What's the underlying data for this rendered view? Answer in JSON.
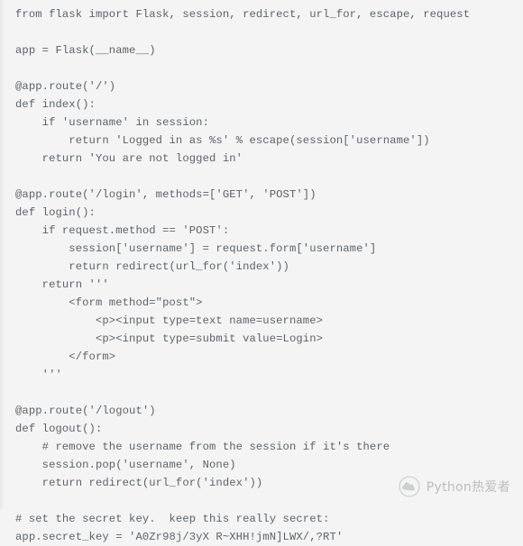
{
  "editor": {
    "language": "python",
    "background_color": "#f4f4f4",
    "text_color": "#5c6369",
    "left_border_color": "#ebebeb",
    "lines": [
      "from flask import Flask, session, redirect, url_for, escape, request",
      "",
      "app = Flask(__name__)",
      "",
      "@app.route('/')",
      "def index():",
      "    if 'username' in session:",
      "        return 'Logged in as %s' % escape(session['username'])",
      "    return 'You are not logged in'",
      "",
      "@app.route('/login', methods=['GET', 'POST'])",
      "def login():",
      "    if request.method == 'POST':",
      "        session['username'] = request.form['username']",
      "        return redirect(url_for('index'))",
      "    return '''",
      "        <form method=\"post\">",
      "            <p><input type=text name=username>",
      "            <p><input type=submit value=Login>",
      "        </form>",
      "    '''",
      "",
      "@app.route('/logout')",
      "def logout():",
      "    # remove the username from the session if it's there",
      "    session.pop('username', None)",
      "    return redirect(url_for('index'))",
      "",
      "# set the secret key.  keep this really secret:",
      "app.secret_key = 'A0Zr98j/3yX R~XHH!jmN]LWX/,?RT'"
    ]
  },
  "watermark": {
    "icon": "cloud-logo-icon",
    "label": "Python热爱者",
    "color": "#6e7276"
  }
}
